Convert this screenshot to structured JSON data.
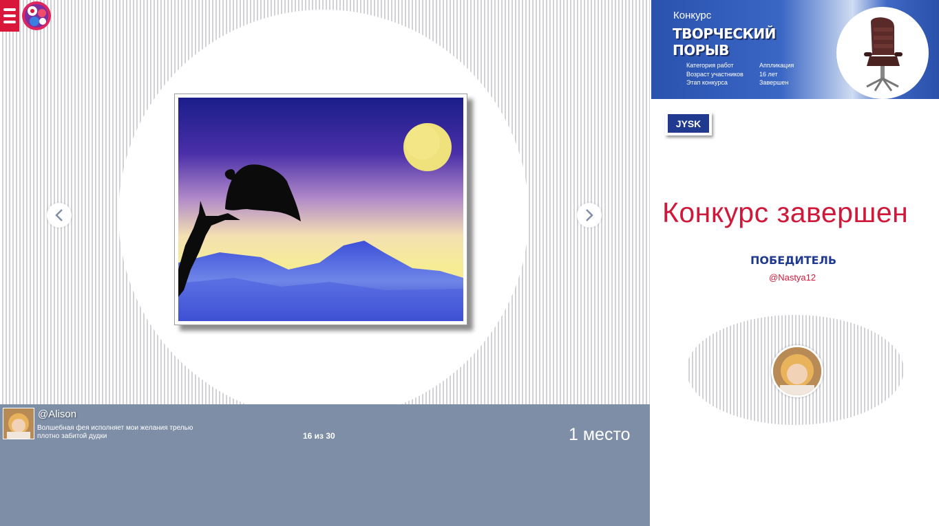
{
  "menu": {
    "icon": "hamburger-menu-icon"
  },
  "logo": {
    "icon": "brand-logo-icon"
  },
  "gallery": {
    "prev_icon": "chevron-left-icon",
    "next_icon": "chevron-right-icon",
    "counter": "16 из 30",
    "place": "1 место"
  },
  "author": {
    "name": "@Alison",
    "description": "Волшебная фея исполняет мои желания трелью плотно забитой дудки"
  },
  "contest": {
    "label": "Конкурс",
    "title": "творческий порыв",
    "info": [
      {
        "key": "Категория работ",
        "value": "Аппликация"
      },
      {
        "key": "Возраст участников",
        "value": "16 лет"
      },
      {
        "key": "Этап конкурса",
        "value": "Завершен"
      }
    ],
    "prize_image": "office-chair",
    "sponsor": "JYSK",
    "status": "Конкурс завершен",
    "winner_label": "Победитель",
    "winner_name": "@Nastya12"
  },
  "colors": {
    "accent_red": "#d0193a",
    "brand_blue": "#1f3a8e",
    "panel_gray_blue": "#7e8ea6"
  }
}
